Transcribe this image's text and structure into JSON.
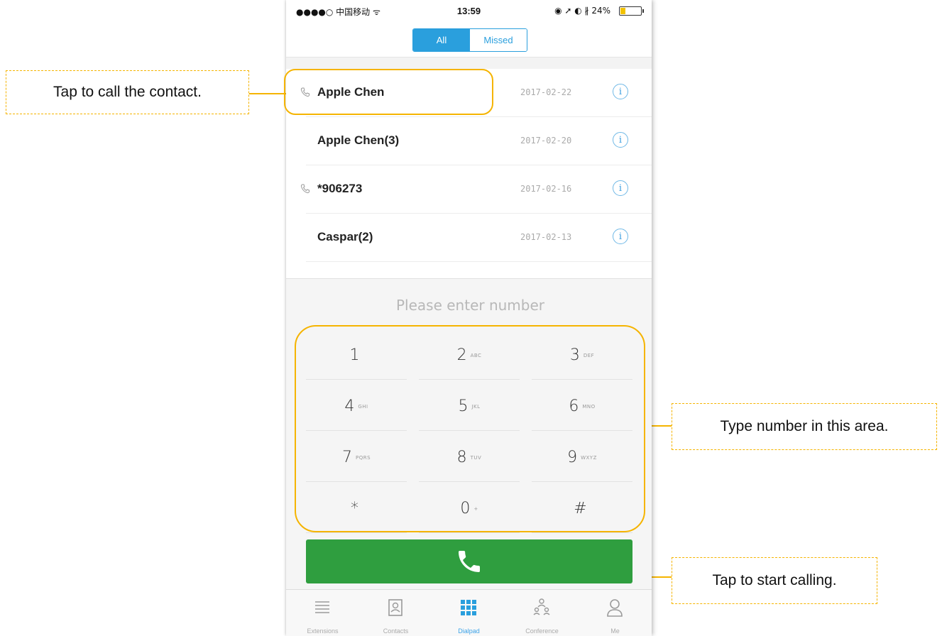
{
  "status_bar": {
    "carrier": "●●●●○ 中国移动 ᯤ",
    "time": "13:59",
    "indicators": "◉ ➚ ◐ ∦ 24%"
  },
  "segment": {
    "all_label": "All",
    "missed_label": "Missed"
  },
  "calls": [
    {
      "name": "Apple Chen",
      "date": "2017-02-22",
      "has_call_icon": true
    },
    {
      "name": "Apple Chen(3)",
      "date": "2017-02-20",
      "has_call_icon": false
    },
    {
      "name": "*906273",
      "date": "2017-02-16",
      "has_call_icon": true
    },
    {
      "name": "Caspar(2)",
      "date": "2017-02-13",
      "has_call_icon": false
    }
  ],
  "info_glyph": "i",
  "dialpad": {
    "placeholder": "Please enter number",
    "keys": [
      {
        "digit": "1",
        "letters": ""
      },
      {
        "digit": "2",
        "letters": "ABC"
      },
      {
        "digit": "3",
        "letters": "DEF"
      },
      {
        "digit": "4",
        "letters": "GHI"
      },
      {
        "digit": "5",
        "letters": "JKL"
      },
      {
        "digit": "6",
        "letters": "MNO"
      },
      {
        "digit": "7",
        "letters": "PQRS"
      },
      {
        "digit": "8",
        "letters": "TUV"
      },
      {
        "digit": "9",
        "letters": "WXYZ"
      },
      {
        "digit": "*",
        "letters": ""
      },
      {
        "digit": "0",
        "letters": "+"
      },
      {
        "digit": "#",
        "letters": ""
      }
    ]
  },
  "tabs": [
    {
      "label": "Extensions",
      "icon": "list-icon"
    },
    {
      "label": "Contacts",
      "icon": "contact-card-icon"
    },
    {
      "label": "Dialpad",
      "icon": "dialpad-grid-icon",
      "active": true
    },
    {
      "label": "Conference",
      "icon": "conference-icon"
    },
    {
      "label": "Me",
      "icon": "person-icon"
    }
  ],
  "callouts": {
    "contact": "Tap to call the contact.",
    "keypad": "Type number in this area.",
    "call": "Tap to start calling."
  },
  "colors": {
    "accent": "#2a9fdd",
    "call_green": "#2f9e3f",
    "highlight": "#f5b400"
  }
}
